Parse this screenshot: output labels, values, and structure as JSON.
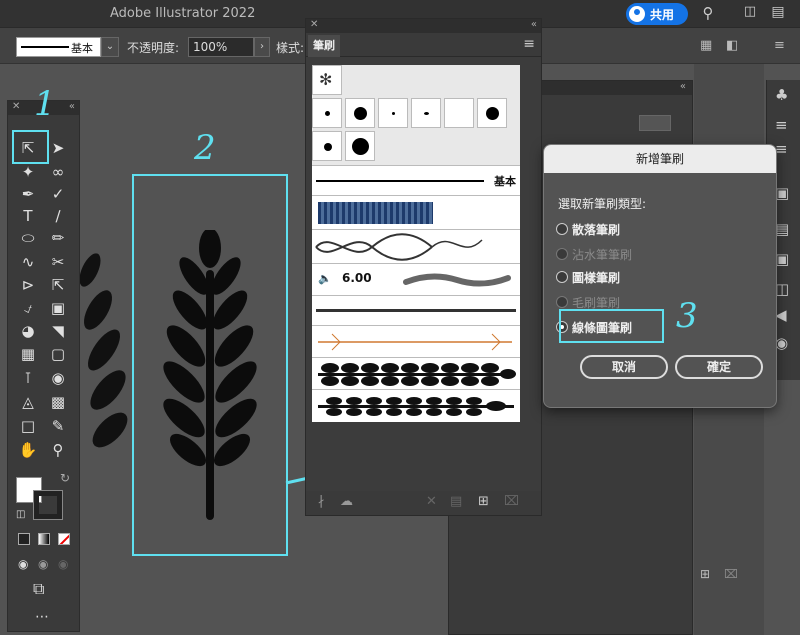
{
  "app": {
    "title": "Adobe Illustrator 2022",
    "share_label": "共用"
  },
  "control_bar": {
    "stroke_style": "基本",
    "opacity_label": "不透明度:",
    "opacity_value": "100%",
    "style_label": "樣式:"
  },
  "annotations": {
    "step1": "1",
    "step2": "2",
    "step3": "3"
  },
  "brushes_panel": {
    "tab_label": "筆刷",
    "basic_label": "基本",
    "size_value": "6.00"
  },
  "dialog": {
    "title": "新增筆刷",
    "prompt": "選取新筆刷類型:",
    "options": [
      {
        "label": "散落筆刷",
        "enabled": true,
        "selected": false
      },
      {
        "label": "沾水筆筆刷",
        "enabled": false,
        "selected": false
      },
      {
        "label": "圖樣筆刷",
        "enabled": true,
        "selected": false
      },
      {
        "label": "毛刷筆刷",
        "enabled": false,
        "selected": false
      },
      {
        "label": "線條圖筆刷",
        "enabled": true,
        "selected": true
      }
    ],
    "cancel_label": "取消",
    "ok_label": "確定"
  },
  "colors": {
    "annotation": "#5fe0f0",
    "share": "#1473e6"
  }
}
